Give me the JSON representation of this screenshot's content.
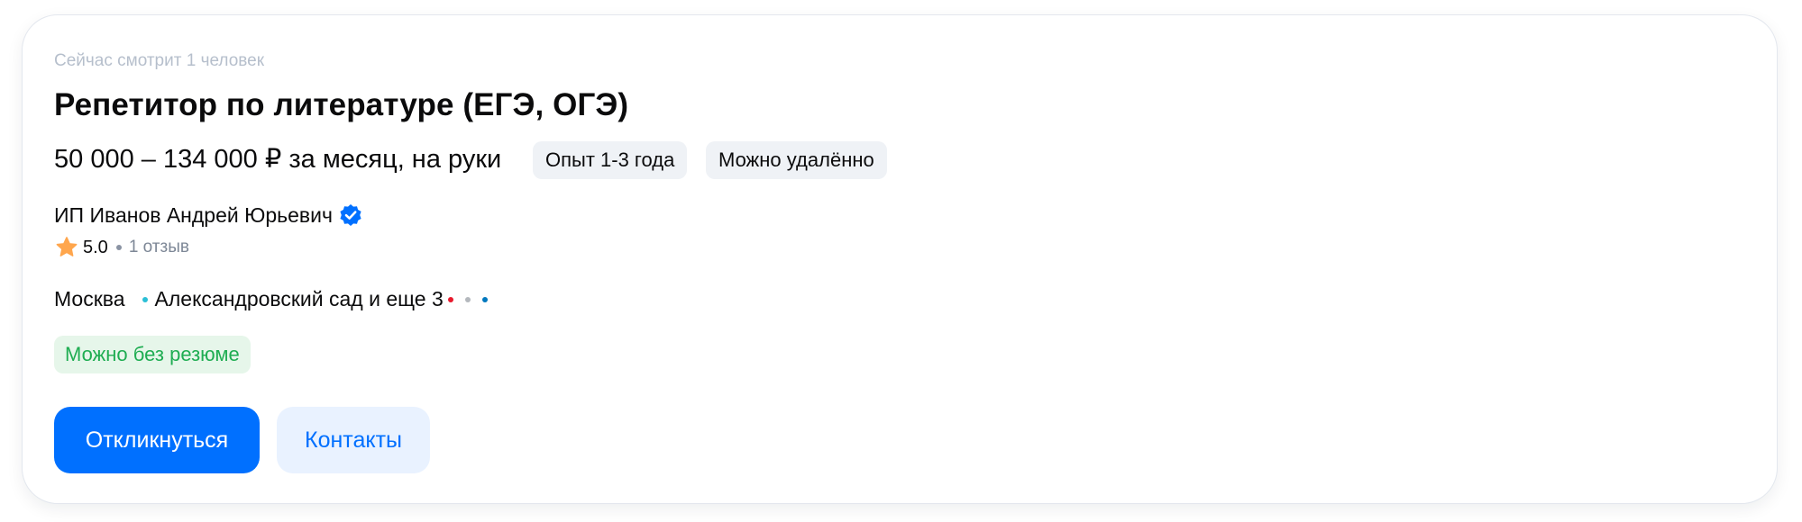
{
  "vacancy": {
    "viewers_text": "Сейчас смотрит 1 человек",
    "title": "Репетитор по литературе (ЕГЭ, ОГЭ)",
    "salary": "50 000 – 134 000 ₽ за месяц, на руки",
    "experience_chip": "Опыт 1-3 года",
    "remote_chip": "Можно удалённо"
  },
  "company": {
    "name": "ИП Иванов Андрей Юрьевич",
    "verified_icon": "verified-badge-icon",
    "rating": "5.0",
    "reviews": "1 отзыв"
  },
  "location": {
    "city": "Москва",
    "metro": "Александровский сад и еще 3",
    "metro_colors": [
      "#2bbfd6",
      "#e8192c",
      "#b4b8bd",
      "#0078be"
    ]
  },
  "badges": {
    "no_resume": "Можно без резюме"
  },
  "actions": {
    "apply_label": "Откликнуться",
    "contacts_label": "Контакты"
  },
  "colors": {
    "accent": "#0070ff",
    "success": "#1fad52",
    "star": "#ffa64d"
  }
}
